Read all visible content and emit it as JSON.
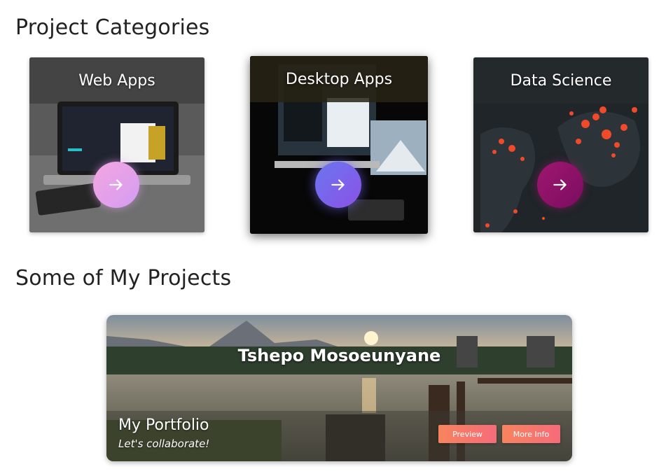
{
  "sections": {
    "categories_title": "Project Categories",
    "projects_title": "Some of My Projects"
  },
  "categories": [
    {
      "label": "Web Apps",
      "icon": "arrow-right-icon",
      "accent": "#e7a3ea"
    },
    {
      "label": "Desktop Apps",
      "icon": "arrow-right-icon",
      "accent": "#7a62ec"
    },
    {
      "label": "Data Science",
      "icon": "arrow-right-icon",
      "accent": "#8e1268"
    }
  ],
  "project": {
    "name": "Tshepo Mosoeunyane",
    "title": "My Portfolio",
    "tagline": "Let's collaborate!",
    "preview_label": "Preview",
    "more_info_label": "More Info",
    "button_color": "#f7785f"
  }
}
